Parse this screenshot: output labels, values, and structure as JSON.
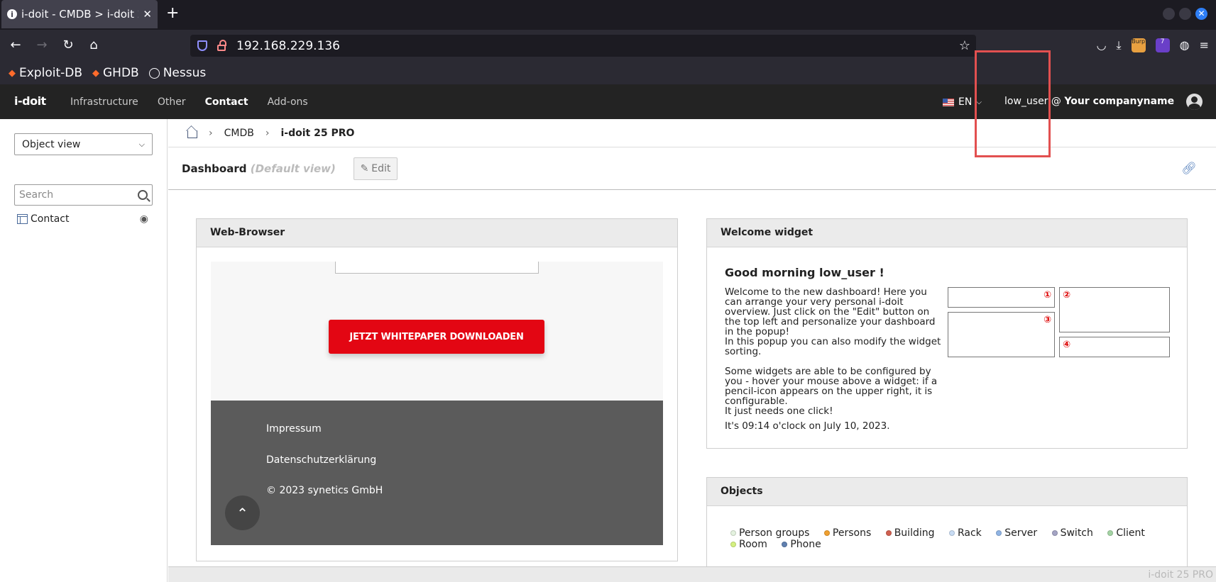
{
  "browser": {
    "tab_title": "i-doit - CMDB > i-doit 25 PRO",
    "url": "192.168.229.136",
    "bookmarks": [
      {
        "label": "Exploit-DB",
        "icon": "exploitdb-icon"
      },
      {
        "label": "GHDB",
        "icon": "exploitdb-icon"
      },
      {
        "label": "Nessus",
        "icon": "globe-icon"
      }
    ],
    "extension_badge": "7",
    "burp_label": "Burp"
  },
  "app": {
    "logo": "i-doit",
    "nav": [
      "Infrastructure",
      "Other",
      "Contact",
      "Add-ons"
    ],
    "active_nav": "Contact",
    "language": "EN",
    "user": "low_user",
    "at": " @ ",
    "company": "Your companyname"
  },
  "sidebar": {
    "view_select": "Object view",
    "search_placeholder": "Search",
    "tree_item": "Contact"
  },
  "breadcrumb": {
    "items": [
      "CMDB",
      "i-doit 25 PRO"
    ]
  },
  "dashboard": {
    "title": "Dashboard",
    "subtitle": "(Default view)",
    "edit_label": "Edit"
  },
  "web_browser_widget": {
    "title": "Web-Browser",
    "button": "JETZT WHITEPAPER DOWNLOADEN",
    "footer_links": [
      "Impressum",
      "Datenschutzerklärung",
      "© 2023 synetics GmbH"
    ]
  },
  "welcome_widget": {
    "title": "Welcome widget",
    "greeting": "Good morning low_user !",
    "paragraph1": "Welcome to the new dashboard! Here you can arrange your very personal i-doit overview. Just click on the \"Edit\" button on the top left and personalize your dashboard in the popup!",
    "paragraph1b": "In this popup you can also modify the widget sorting.",
    "paragraph2": "Some widgets are able to be configured by you - hover your mouse above a widget: if a pencil-icon appears on the upper right, it is configurable.",
    "paragraph2b": "It just needs one click!",
    "clock": "It's 09:14 o'clock on July 10, 2023.",
    "markers": [
      "①",
      "②",
      "③",
      "④"
    ]
  },
  "objects_widget": {
    "title": "Objects",
    "legend": [
      {
        "label": "Person groups",
        "color": "#e4f2df"
      },
      {
        "label": "Persons",
        "color": "#f0a030"
      },
      {
        "label": "Building",
        "color": "#d06050"
      },
      {
        "label": "Rack",
        "color": "#c8dcf4"
      },
      {
        "label": "Server",
        "color": "#90b4e4"
      },
      {
        "label": "Switch",
        "color": "#a4a4c4"
      },
      {
        "label": "Client",
        "color": "#a4d4a4"
      },
      {
        "label": "Room",
        "color": "#d4f080"
      },
      {
        "label": "Phone",
        "color": "#6080b0"
      }
    ]
  },
  "status_bar": "i-doit 25 PRO"
}
